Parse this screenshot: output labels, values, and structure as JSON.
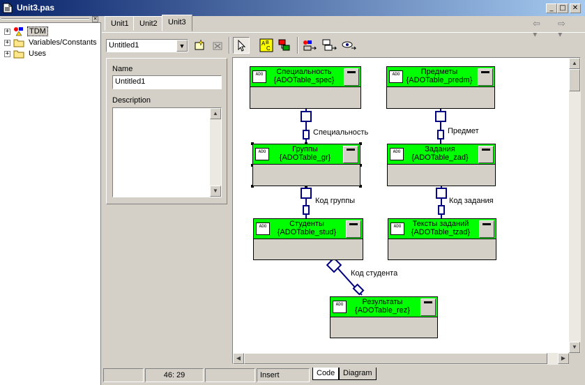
{
  "window": {
    "title": "Unit3.pas"
  },
  "tree": [
    {
      "label": "TDM",
      "icon": "datamodule-icon",
      "selected": true
    },
    {
      "label": "Variables/Constants",
      "icon": "folder-icon"
    },
    {
      "label": "Uses",
      "icon": "folder-icon"
    }
  ],
  "tabs": [
    {
      "label": "Unit1"
    },
    {
      "label": "Unit2"
    },
    {
      "label": "Unit3"
    }
  ],
  "toolbar": {
    "diagram_select": "Untitled1"
  },
  "props": {
    "name_label": "Name",
    "name_value": "Untitled1",
    "desc_label": "Description"
  },
  "diagram": {
    "tables": [
      {
        "line1": "Специальность",
        "line2": "{ADOTable_spec}"
      },
      {
        "line1": "Предметы",
        "line2": "{ADOTable_predm}"
      },
      {
        "line1": "Группы",
        "line2": "{ADOTable_gr}"
      },
      {
        "line1": "Задания",
        "line2": "{ADOTable_zad}"
      },
      {
        "line1": "Студенты",
        "line2": "{ADOTable_stud}"
      },
      {
        "line1": "Тексты заданий",
        "line2": "{ADOTable_tzad}"
      },
      {
        "line1": "Результаты",
        "line2": "{ADOTable_rez}"
      }
    ],
    "relations": [
      {
        "label": "Специальность"
      },
      {
        "label": "Предмет"
      },
      {
        "label": "Код группы"
      },
      {
        "label": "Код задания"
      },
      {
        "label": "Код студента"
      }
    ]
  },
  "status": {
    "position": "46:  29",
    "mode": "Insert",
    "tab_code": "Code",
    "tab_diagram": "Diagram"
  },
  "colors": {
    "table_header": "#00ff00",
    "link": "#000080"
  }
}
